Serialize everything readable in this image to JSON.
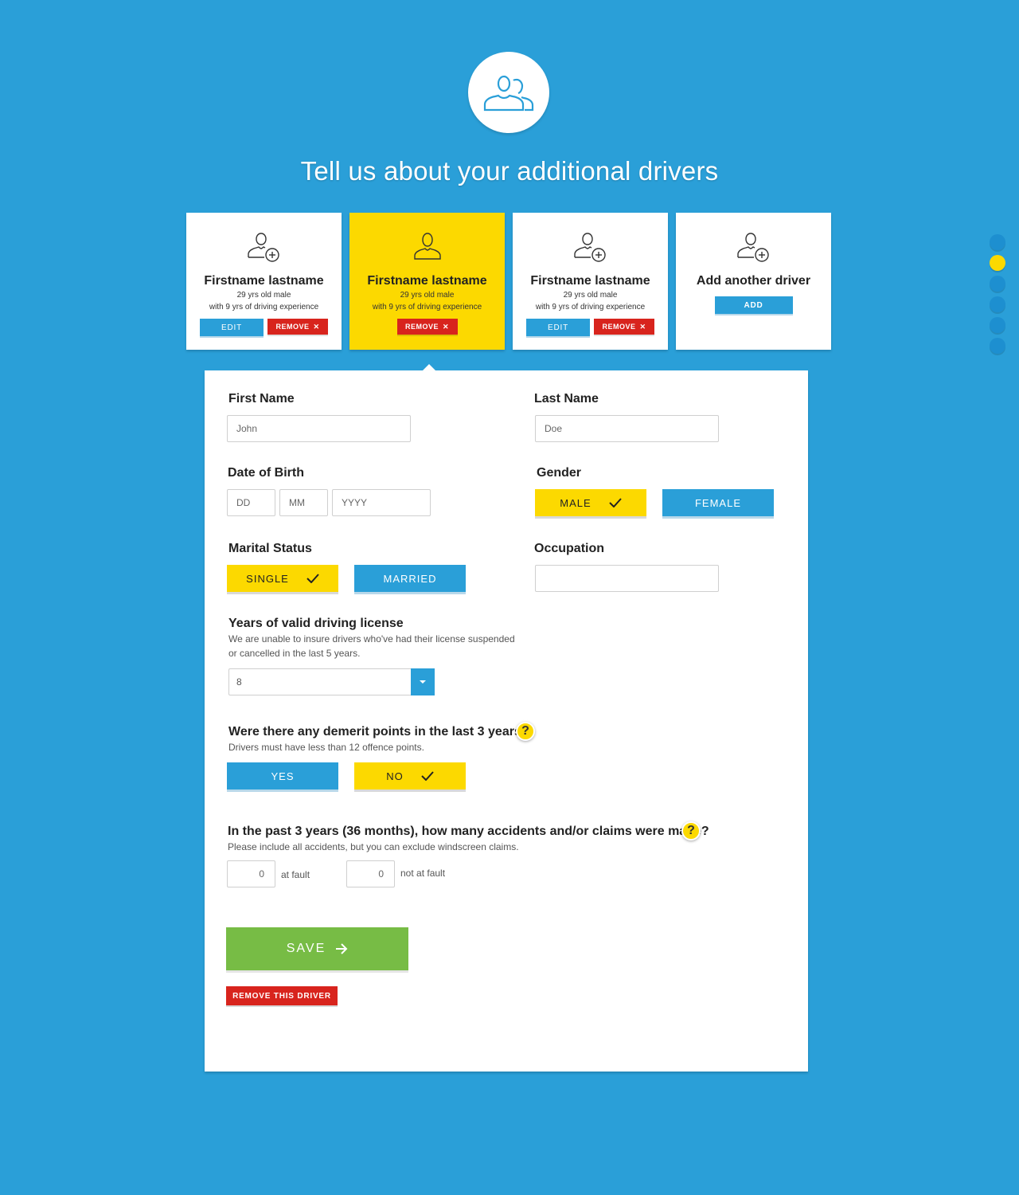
{
  "title": "Tell us about your additional drivers",
  "cards": [
    {
      "name": "Firstname lastname",
      "age": "29 yrs old male",
      "experience": "with 9 yrs of driving experience",
      "edit": "EDIT",
      "remove": "REMOVE"
    },
    {
      "name": "Firstname lastname",
      "age": "29 yrs old male",
      "experience": "with 9 yrs of driving experience",
      "remove": "REMOVE"
    },
    {
      "name": "Firstname lastname",
      "age": "29 yrs old male",
      "experience": "with 9 yrs of driving experience",
      "edit": "EDIT",
      "remove": "REMOVE"
    },
    {
      "name": "Add another driver",
      "add": "ADD"
    }
  ],
  "pager": {
    "count": 6,
    "active_index": 1
  },
  "form": {
    "first_name": {
      "label": "First Name",
      "value": "John"
    },
    "last_name": {
      "label": "Last Name",
      "value": "Doe"
    },
    "dob": {
      "label": "Date of Birth",
      "dd": "DD",
      "mm": "MM",
      "yyyy": "YYYY"
    },
    "gender": {
      "label": "Gender",
      "male": "MALE",
      "female": "FEMALE",
      "selected": "MALE"
    },
    "marital": {
      "label": "Marital Status",
      "single": "SINGLE",
      "married": "MARRIED",
      "selected": "SINGLE"
    },
    "occupation": {
      "label": "Occupation",
      "value": ""
    },
    "license": {
      "label": "Years of valid driving license",
      "help_line1": "We are unable to insure drivers who've had their license suspended",
      "help_line2": "or cancelled in the last 5 years.",
      "value": "8"
    },
    "demerit": {
      "label": "Were there any demerit points in the last 3 years?",
      "help": "Drivers must have less than 12 offence points.",
      "yes": "YES",
      "no": "NO",
      "selected": "NO",
      "help_icon": "?"
    },
    "accidents": {
      "label": "In the past 3 years (36 months), how many accidents and/or claims were made?",
      "help": "Please include all accidents, but you can exclude windscreen claims.",
      "at_fault_value": "0",
      "at_fault_label": "at fault",
      "not_at_fault_value": "0",
      "not_at_fault_label": "not at fault",
      "help_icon": "?"
    },
    "save": "SAVE",
    "remove_driver": "REMOVE THIS DRIVER"
  },
  "colors": {
    "background": "#2a9fd8",
    "accent_yellow": "#fcd900",
    "danger": "#d8241d",
    "success": "#77bc45"
  }
}
